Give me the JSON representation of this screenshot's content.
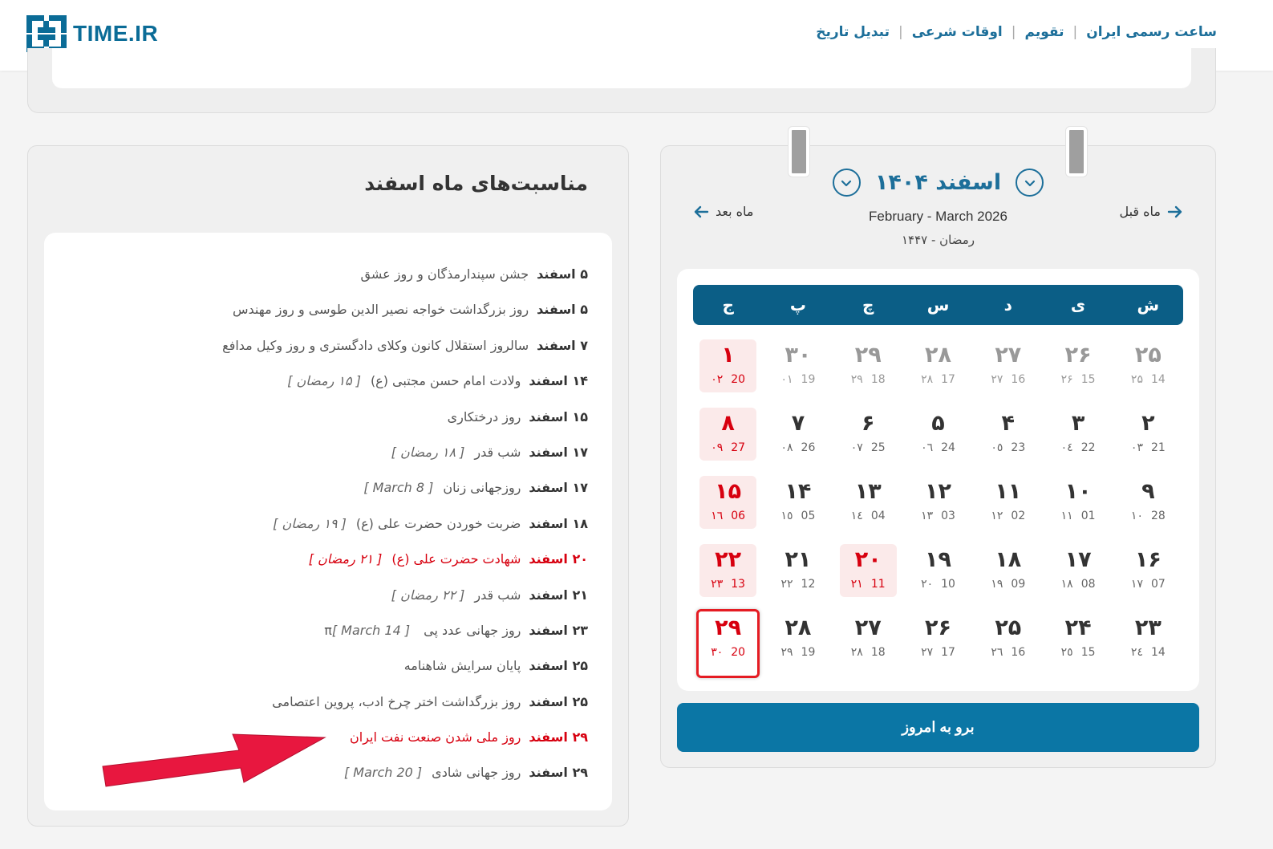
{
  "header": {
    "logo_text": "TIME.IR",
    "nav": [
      {
        "label": "ساعت رسمی ایران"
      },
      {
        "label": "تقویم"
      },
      {
        "label": "اوقات شرعی"
      },
      {
        "label": "تبدیل تاریخ"
      }
    ],
    "separator": "|"
  },
  "occasions": {
    "title": "مناسبت‌های ماه اسفند",
    "items": [
      {
        "date": "۵ اسفند",
        "text": "جشن سپندارمذگان و روز عشق",
        "extra": "",
        "holiday": false
      },
      {
        "date": "۵ اسفند",
        "text": "روز بزرگداشت خواجه نصیر الدین طوسی و روز مهندس",
        "extra": "",
        "holiday": false
      },
      {
        "date": "۷ اسفند",
        "text": "سالروز استقلال کانون وکلای دادگستری و روز وکیل مدافع",
        "extra": "",
        "holiday": false
      },
      {
        "date": "۱۴ اسفند",
        "text": "ولادت امام حسن مجتبی (ع)",
        "extra": "[ ۱۵ رمضان ]",
        "holiday": false
      },
      {
        "date": "۱۵ اسفند",
        "text": "روز درختکاری",
        "extra": "",
        "holiday": false
      },
      {
        "date": "۱۷ اسفند",
        "text": "شب قدر",
        "extra": "[ ۱۸ رمضان ]",
        "holiday": false
      },
      {
        "date": "۱۷ اسفند",
        "text": "روزجهانی زنان",
        "extra": "[ March 8 ]",
        "holiday": false
      },
      {
        "date": "۱۸ اسفند",
        "text": "ضربت خوردن حضرت علی (ع)",
        "extra": "[ ۱۹ رمضان ]",
        "holiday": false
      },
      {
        "date": "۲۰ اسفند",
        "text": "شهادت حضرت علی (ع)",
        "extra": "[ ۲۱ رمضان ]",
        "holiday": true
      },
      {
        "date": "۲۱ اسفند",
        "text": "شب قدر",
        "extra": "[ ۲۲ رمضان ]",
        "holiday": false
      },
      {
        "date": "۲۳ اسفند",
        "text": "روز جهانی عدد پی π",
        "extra": "[ March 14 ]",
        "holiday": false
      },
      {
        "date": "۲۵ اسفند",
        "text": "پایان سرایش شاهنامه",
        "extra": "",
        "holiday": false
      },
      {
        "date": "۲۵ اسفند",
        "text": "روز بزرگداشت اختر چرخ ادب، پروین اعتصامی",
        "extra": "",
        "holiday": false
      },
      {
        "date": "۲۹ اسفند",
        "text": "روز ملی شدن صنعت نفت ایران",
        "extra": "",
        "holiday": true
      },
      {
        "date": "۲۹ اسفند",
        "text": "روز جهانی شادی",
        "extra": "[ March 20 ]",
        "holiday": false
      }
    ]
  },
  "calendar": {
    "month_title": "اسفند ۱۴۰۴",
    "gregorian": "February - March 2026",
    "hijri": "رمضان - ۱۴۴۷",
    "prev_label": "ماه قبل",
    "next_label": "ماه بعد",
    "weekdays": [
      "ش",
      "ی",
      "د",
      "س",
      "چ",
      "پ",
      "ج"
    ],
    "days": [
      {
        "n": "۲۵",
        "g": "14",
        "h": "۲۵",
        "prev": true,
        "holiday": false
      },
      {
        "n": "۲۶",
        "g": "15",
        "h": "۲۶",
        "prev": true,
        "holiday": false
      },
      {
        "n": "۲۷",
        "g": "16",
        "h": "۲۷",
        "prev": true,
        "holiday": false
      },
      {
        "n": "۲۸",
        "g": "17",
        "h": "۲۸",
        "prev": true,
        "holiday": false
      },
      {
        "n": "۲۹",
        "g": "18",
        "h": "۲۹",
        "prev": true,
        "holiday": false
      },
      {
        "n": "۳۰",
        "g": "19",
        "h": "۰۱",
        "prev": true,
        "holiday": false
      },
      {
        "n": "۱",
        "g": "20",
        "h": "۰۲",
        "prev": false,
        "holiday": true
      },
      {
        "n": "۲",
        "g": "21",
        "h": "۰۳",
        "prev": false,
        "holiday": false
      },
      {
        "n": "۳",
        "g": "22",
        "h": "۰٤",
        "prev": false,
        "holiday": false
      },
      {
        "n": "۴",
        "g": "23",
        "h": "۰٥",
        "prev": false,
        "holiday": false
      },
      {
        "n": "۵",
        "g": "24",
        "h": "۰٦",
        "prev": false,
        "holiday": false
      },
      {
        "n": "۶",
        "g": "25",
        "h": "۰۷",
        "prev": false,
        "holiday": false
      },
      {
        "n": "۷",
        "g": "26",
        "h": "۰۸",
        "prev": false,
        "holiday": false
      },
      {
        "n": "۸",
        "g": "27",
        "h": "۰۹",
        "prev": false,
        "holiday": true
      },
      {
        "n": "۹",
        "g": "28",
        "h": "۱۰",
        "prev": false,
        "holiday": false
      },
      {
        "n": "۱۰",
        "g": "01",
        "h": "۱۱",
        "prev": false,
        "holiday": false
      },
      {
        "n": "۱۱",
        "g": "02",
        "h": "۱۲",
        "prev": false,
        "holiday": false
      },
      {
        "n": "۱۲",
        "g": "03",
        "h": "۱۳",
        "prev": false,
        "holiday": false
      },
      {
        "n": "۱۳",
        "g": "04",
        "h": "۱٤",
        "prev": false,
        "holiday": false
      },
      {
        "n": "۱۴",
        "g": "05",
        "h": "۱٥",
        "prev": false,
        "holiday": false
      },
      {
        "n": "۱۵",
        "g": "06",
        "h": "۱٦",
        "prev": false,
        "holiday": true
      },
      {
        "n": "۱۶",
        "g": "07",
        "h": "۱۷",
        "prev": false,
        "holiday": false
      },
      {
        "n": "۱۷",
        "g": "08",
        "h": "۱۸",
        "prev": false,
        "holiday": false
      },
      {
        "n": "۱۸",
        "g": "09",
        "h": "۱۹",
        "prev": false,
        "holiday": false
      },
      {
        "n": "۱۹",
        "g": "10",
        "h": "۲۰",
        "prev": false,
        "holiday": false
      },
      {
        "n": "۲۰",
        "g": "11",
        "h": "۲۱",
        "prev": false,
        "holiday": true
      },
      {
        "n": "۲۱",
        "g": "12",
        "h": "۲۲",
        "prev": false,
        "holiday": false
      },
      {
        "n": "۲۲",
        "g": "13",
        "h": "۲۳",
        "prev": false,
        "holiday": true
      },
      {
        "n": "۲۳",
        "g": "14",
        "h": "۲٤",
        "prev": false,
        "holiday": false
      },
      {
        "n": "۲۴",
        "g": "15",
        "h": "۲٥",
        "prev": false,
        "holiday": false
      },
      {
        "n": "۲۵",
        "g": "16",
        "h": "۲٦",
        "prev": false,
        "holiday": false
      },
      {
        "n": "۲۶",
        "g": "17",
        "h": "۲۷",
        "prev": false,
        "holiday": false
      },
      {
        "n": "۲۷",
        "g": "18",
        "h": "۲۸",
        "prev": false,
        "holiday": false
      },
      {
        "n": "۲۸",
        "g": "19",
        "h": "۲۹",
        "prev": false,
        "holiday": false
      },
      {
        "n": "۲۹",
        "g": "20",
        "h": "۳۰",
        "prev": false,
        "holiday": true,
        "today": true
      }
    ],
    "today_button": "برو به امروز"
  },
  "colors": {
    "accent": "#1d6f9a",
    "header_bar": "#0b5e86",
    "button": "#0b76a5",
    "holiday": "#d7000f",
    "annotation_arrow": "#e8173f"
  }
}
